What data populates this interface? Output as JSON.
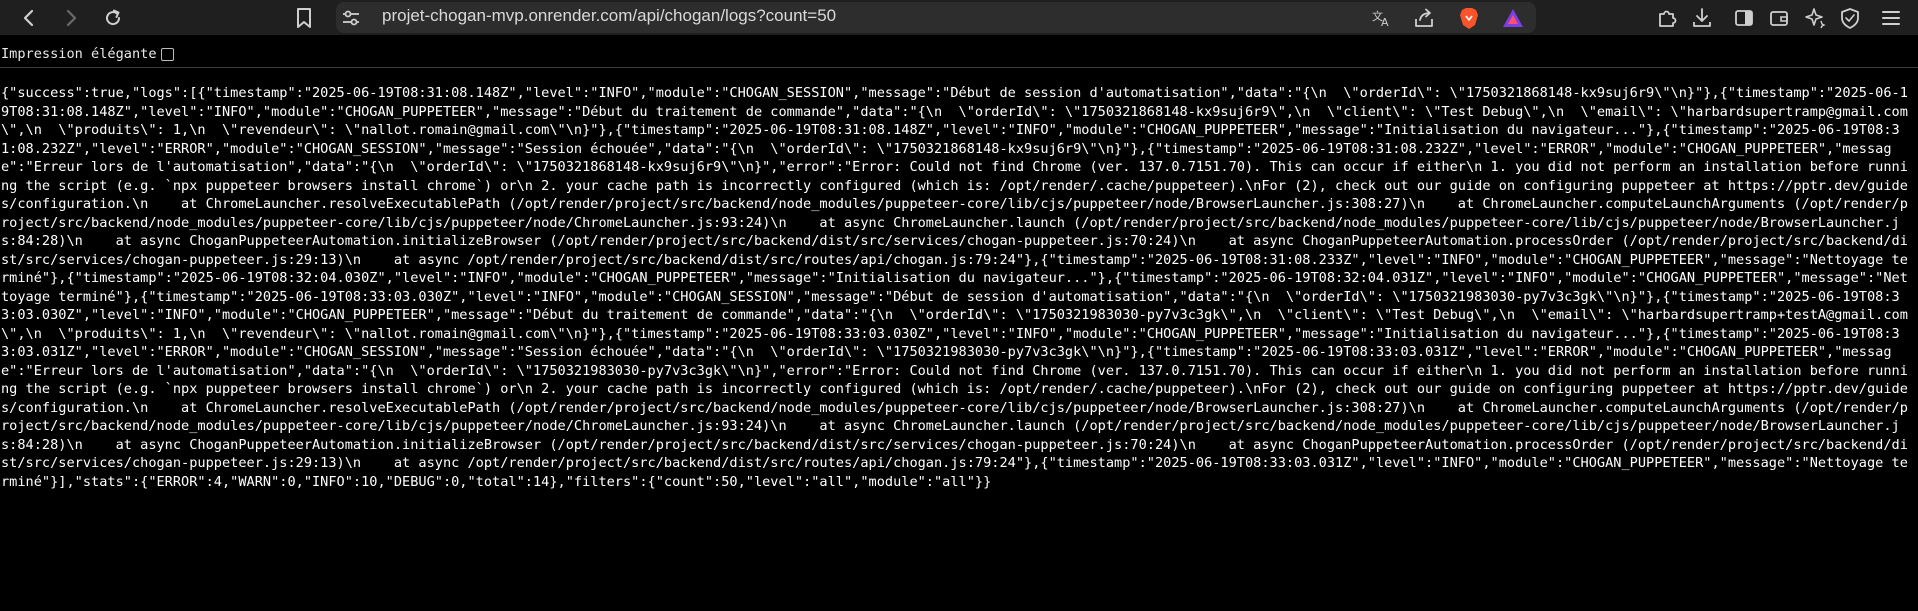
{
  "browser": {
    "url": "projet-chogan-mvp.onrender.com/api/chogan/logs?count=50",
    "colors": {
      "toolbar": "#1f1f1f",
      "urlbar": "#2d2d2d",
      "brave_orange": "#fb542b",
      "triangle_purple": "#7b3fe4"
    },
    "icons": {
      "back": "arrow-left-icon",
      "forward": "arrow-right-icon",
      "reload": "reload-icon",
      "bookmark": "bookmark-icon",
      "site_info": "tune-icon",
      "translate": "translate-icon",
      "share": "share-icon",
      "brave_shields": "brave-lion-icon",
      "brave_rewards": "triangle-rewards-icon",
      "extensions": "puzzle-icon",
      "downloads": "download-icon",
      "sidebar": "sidebar-icon",
      "wallet": "wallet-icon",
      "leo": "sparkle-icon",
      "vpn": "vpn-shield-icon",
      "menu": "hamburger-menu-icon"
    }
  },
  "viewer": {
    "pretty_print_label": "Impression élégante",
    "pretty_print_checked": false
  },
  "raw_json": "{\"success\":true,\"logs\":[{\"timestamp\":\"2025-06-19T08:31:08.148Z\",\"level\":\"INFO\",\"module\":\"CHOGAN_SESSION\",\"message\":\"Début de session d'automatisation\",\"data\":\"{\\n  \\\"orderId\\\": \\\"1750321868148-kx9suj6r9\\\"\\n}\"},{\"timestamp\":\"2025-06-19T08:31:08.148Z\",\"level\":\"INFO\",\"module\":\"CHOGAN_PUPPETEER\",\"message\":\"Début du traitement de commande\",\"data\":\"{\\n  \\\"orderId\\\": \\\"1750321868148-kx9suj6r9\\\",\\n  \\\"client\\\": \\\"Test Debug\\\",\\n  \\\"email\\\": \\\"harbardsupertramp@gmail.com\\\",\\n  \\\"produits\\\": 1,\\n  \\\"revendeur\\\": \\\"nallot.romain@gmail.com\\\"\\n}\"},{\"timestamp\":\"2025-06-19T08:31:08.148Z\",\"level\":\"INFO\",\"module\":\"CHOGAN_PUPPETEER\",\"message\":\"Initialisation du navigateur...\"},{\"timestamp\":\"2025-06-19T08:31:08.232Z\",\"level\":\"ERROR\",\"module\":\"CHOGAN_SESSION\",\"message\":\"Session échouée\",\"data\":\"{\\n  \\\"orderId\\\": \\\"1750321868148-kx9suj6r9\\\"\\n}\"},{\"timestamp\":\"2025-06-19T08:31:08.232Z\",\"level\":\"ERROR\",\"module\":\"CHOGAN_PUPPETEER\",\"message\":\"Erreur lors de l'automatisation\",\"data\":\"{\\n  \\\"orderId\\\": \\\"1750321868148-kx9suj6r9\\\"\\n}\",\"error\":\"Error: Could not find Chrome (ver. 137.0.7151.70). This can occur if either\\n 1. you did not perform an installation before running the script (e.g. `npx puppeteer browsers install chrome`) or\\n 2. your cache path is incorrectly configured (which is: /opt/render/.cache/puppeteer).\\nFor (2), check out our guide on configuring puppeteer at https://pptr.dev/guides/configuration.\\n    at ChromeLauncher.resolveExecutablePath (/opt/render/project/src/backend/node_modules/puppeteer-core/lib/cjs/puppeteer/node/BrowserLauncher.js:308:27)\\n    at ChromeLauncher.computeLaunchArguments (/opt/render/project/src/backend/node_modules/puppeteer-core/lib/cjs/puppeteer/node/ChromeLauncher.js:93:24)\\n    at async ChromeLauncher.launch (/opt/render/project/src/backend/node_modules/puppeteer-core/lib/cjs/puppeteer/node/BrowserLauncher.js:84:28)\\n    at async ChoganPuppeteerAutomation.initializeBrowser (/opt/render/project/src/backend/dist/src/services/chogan-puppeteer.js:70:24)\\n    at async ChoganPuppeteerAutomation.processOrder (/opt/render/project/src/backend/dist/src/services/chogan-puppeteer.js:29:13)\\n    at async /opt/render/project/src/backend/dist/src/routes/api/chogan.js:79:24\"},{\"timestamp\":\"2025-06-19T08:31:08.233Z\",\"level\":\"INFO\",\"module\":\"CHOGAN_PUPPETEER\",\"message\":\"Nettoyage terminé\"},{\"timestamp\":\"2025-06-19T08:32:04.030Z\",\"level\":\"INFO\",\"module\":\"CHOGAN_PUPPETEER\",\"message\":\"Initialisation du navigateur...\"},{\"timestamp\":\"2025-06-19T08:32:04.031Z\",\"level\":\"INFO\",\"module\":\"CHOGAN_PUPPETEER\",\"message\":\"Nettoyage terminé\"},{\"timestamp\":\"2025-06-19T08:33:03.030Z\",\"level\":\"INFO\",\"module\":\"CHOGAN_SESSION\",\"message\":\"Début de session d'automatisation\",\"data\":\"{\\n  \\\"orderId\\\": \\\"1750321983030-py7v3c3gk\\\"\\n}\"},{\"timestamp\":\"2025-06-19T08:33:03.030Z\",\"level\":\"INFO\",\"module\":\"CHOGAN_PUPPETEER\",\"message\":\"Début du traitement de commande\",\"data\":\"{\\n  \\\"orderId\\\": \\\"1750321983030-py7v3c3gk\\\",\\n  \\\"client\\\": \\\"Test Debug\\\",\\n  \\\"email\\\": \\\"harbardsupertramp+testA@gmail.com\\\",\\n  \\\"produits\\\": 1,\\n  \\\"revendeur\\\": \\\"nallot.romain@gmail.com\\\"\\n}\"},{\"timestamp\":\"2025-06-19T08:33:03.030Z\",\"level\":\"INFO\",\"module\":\"CHOGAN_PUPPETEER\",\"message\":\"Initialisation du navigateur...\"},{\"timestamp\":\"2025-06-19T08:33:03.031Z\",\"level\":\"ERROR\",\"module\":\"CHOGAN_SESSION\",\"message\":\"Session échouée\",\"data\":\"{\\n  \\\"orderId\\\": \\\"1750321983030-py7v3c3gk\\\"\\n}\"},{\"timestamp\":\"2025-06-19T08:33:03.031Z\",\"level\":\"ERROR\",\"module\":\"CHOGAN_PUPPETEER\",\"message\":\"Erreur lors de l'automatisation\",\"data\":\"{\\n  \\\"orderId\\\": \\\"1750321983030-py7v3c3gk\\\"\\n}\",\"error\":\"Error: Could not find Chrome (ver. 137.0.7151.70). This can occur if either\\n 1. you did not perform an installation before running the script (e.g. `npx puppeteer browsers install chrome`) or\\n 2. your cache path is incorrectly configured (which is: /opt/render/.cache/puppeteer).\\nFor (2), check out our guide on configuring puppeteer at https://pptr.dev/guides/configuration.\\n    at ChromeLauncher.resolveExecutablePath (/opt/render/project/src/backend/node_modules/puppeteer-core/lib/cjs/puppeteer/node/BrowserLauncher.js:308:27)\\n    at ChromeLauncher.computeLaunchArguments (/opt/render/project/src/backend/node_modules/puppeteer-core/lib/cjs/puppeteer/node/ChromeLauncher.js:93:24)\\n    at async ChromeLauncher.launch (/opt/render/project/src/backend/node_modules/puppeteer-core/lib/cjs/puppeteer/node/BrowserLauncher.js:84:28)\\n    at async ChoganPuppeteerAutomation.initializeBrowser (/opt/render/project/src/backend/dist/src/services/chogan-puppeteer.js:70:24)\\n    at async ChoganPuppeteerAutomation.processOrder (/opt/render/project/src/backend/dist/src/services/chogan-puppeteer.js:29:13)\\n    at async /opt/render/project/src/backend/dist/src/routes/api/chogan.js:79:24\"},{\"timestamp\":\"2025-06-19T08:33:03.031Z\",\"level\":\"INFO\",\"module\":\"CHOGAN_PUPPETEER\",\"message\":\"Nettoyage terminé\"}],\"stats\":{\"ERROR\":4,\"WARN\":0,\"INFO\":10,\"DEBUG\":0,\"total\":14},\"filters\":{\"count\":50,\"level\":\"all\",\"module\":\"all\"}}"
}
